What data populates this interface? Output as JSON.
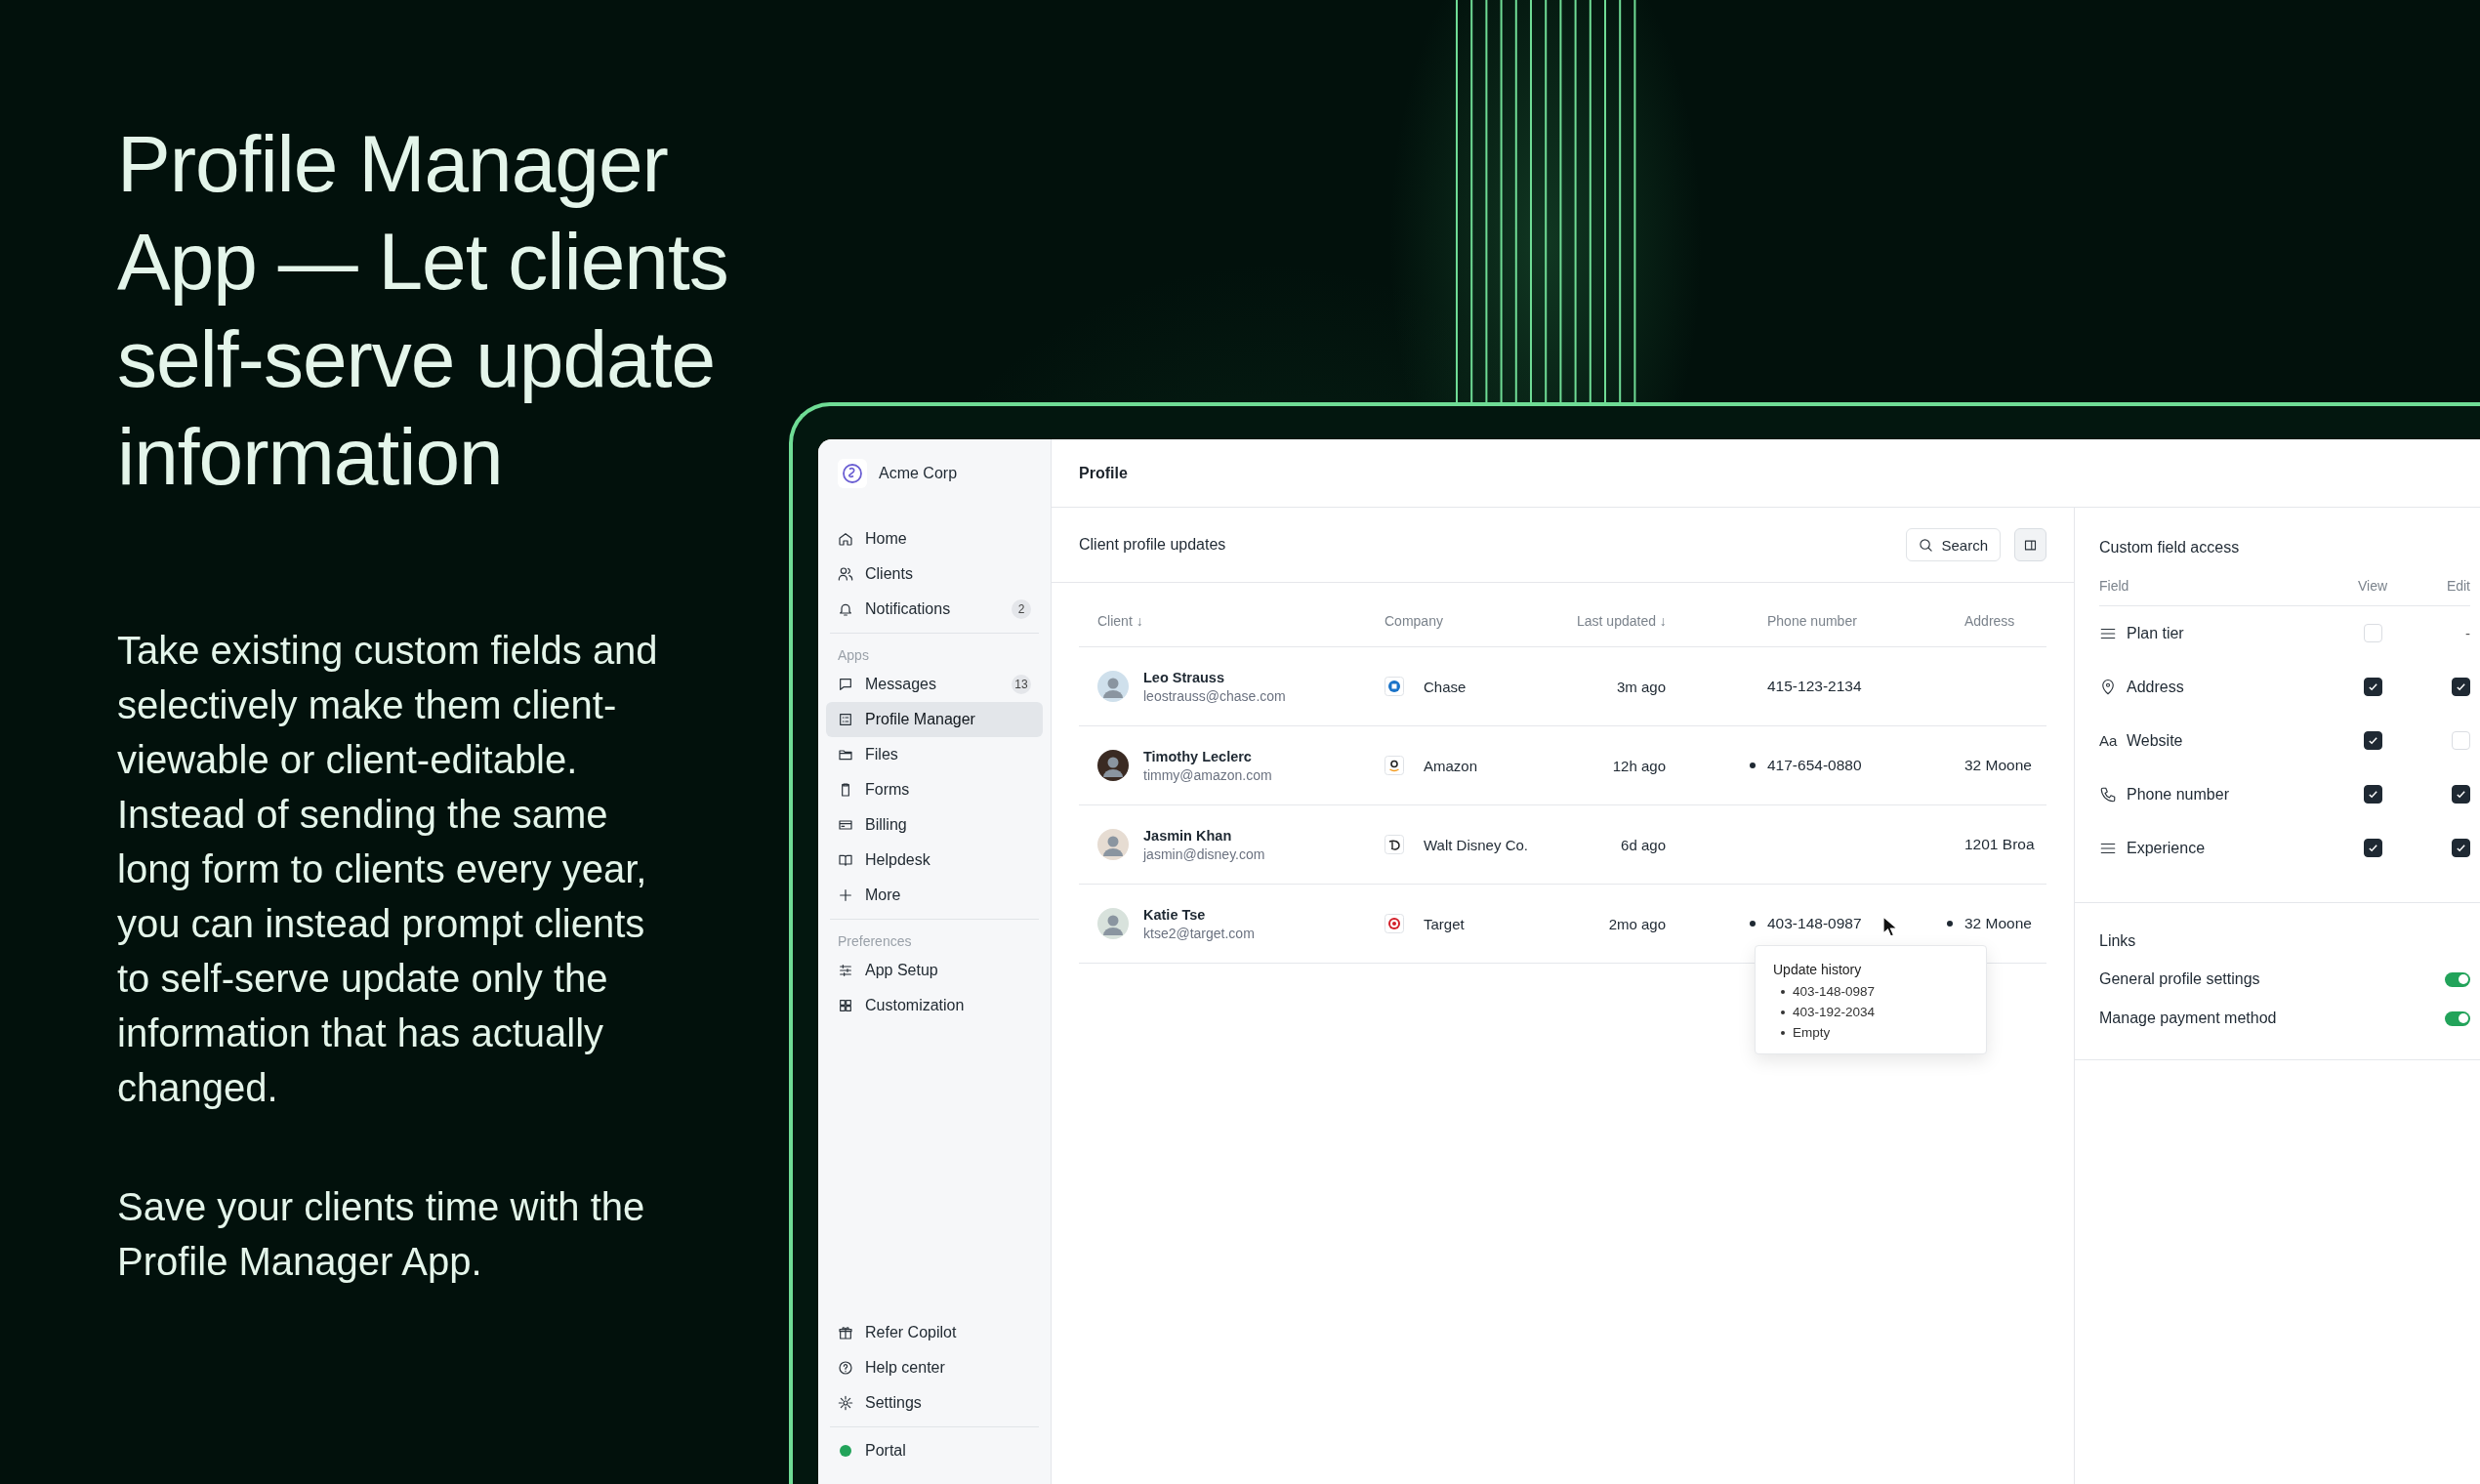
{
  "hero": {
    "title": "Profile Manager App — Let clients self-serve update information",
    "paragraphs": [
      "Take existing custom fields and selectively make them client-viewable or client-editable. Instead of sending the same long form to clients every year, you can instead prompt clients to self-serve update only the information that has actually changed.",
      "Save your clients time with the Profile Manager App."
    ]
  },
  "app": {
    "brand": "Acme Corp",
    "nav": [
      {
        "items": [
          {
            "label": "Home",
            "selected": false
          },
          {
            "label": "Clients",
            "selected": false
          },
          {
            "label": "Notifications",
            "badge": "2",
            "selected": false
          }
        ]
      },
      {
        "title": "Apps",
        "items": [
          {
            "label": "Messages",
            "badge": "13",
            "selected": false
          },
          {
            "label": "Profile Manager",
            "selected": true
          },
          {
            "label": "Files",
            "selected": false
          },
          {
            "label": "Forms",
            "selected": false
          },
          {
            "label": "Billing",
            "selected": false
          },
          {
            "label": "Helpdesk",
            "selected": false
          },
          {
            "label": "More",
            "selected": false
          }
        ]
      },
      {
        "title": "Preferences",
        "items": [
          {
            "label": "App Setup",
            "selected": false
          },
          {
            "label": "Customization",
            "selected": false
          }
        ]
      }
    ],
    "footer_nav": [
      {
        "label": "Refer Copilot",
        "selected": false
      },
      {
        "label": "Help center",
        "selected": false
      },
      {
        "label": "Settings",
        "selected": false
      }
    ],
    "portal": {
      "label": "Portal"
    },
    "page_title": "Profile",
    "section_title": "Client profile updates",
    "search_label": "Search",
    "columns": [
      "Client ↓",
      "Company",
      "Last updated ↓",
      "Phone number",
      "Address"
    ],
    "rows": [
      {
        "name": "Leo Strauss",
        "email": "leostrauss@chase.com",
        "company": "Chase",
        "updated": "3m ago",
        "phone": {
          "text": "415-123-2134",
          "changed": false
        }
      },
      {
        "name": "Timothy Leclerc",
        "email": "timmy@amazon.com",
        "company": "Amazon",
        "updated": "12h ago",
        "phone": {
          "text": "417-654-0880",
          "changed": true
        },
        "address": {
          "text": "32 Moone",
          "changed": false
        }
      },
      {
        "name": "Jasmin Khan",
        "email": "jasmin@disney.com",
        "company": "Walt Disney Co.",
        "updated": "6d ago",
        "address": {
          "text": "1201 Broa",
          "changed": false
        }
      },
      {
        "name": "Katie Tse",
        "email": "ktse2@target.com",
        "company": "Target",
        "updated": "2mo ago",
        "phone": {
          "text": "403-148-0987",
          "changed": true
        },
        "address": {
          "text": "32 Moone",
          "changed": true
        }
      }
    ],
    "tooltip": {
      "title": "Update history",
      "items": [
        "403-148-0987",
        "403-192-2034",
        "Empty"
      ]
    },
    "panel": {
      "title": "Custom field access",
      "columns": [
        "Field",
        "View",
        "Edit"
      ],
      "fields": [
        {
          "label": "Plan tier",
          "view": false,
          "edit_text": "-"
        },
        {
          "label": "Address",
          "view": true,
          "edit": true
        },
        {
          "label": "Website",
          "glyph": "Aa",
          "view": true,
          "edit": false
        },
        {
          "label": "Phone number",
          "view": true,
          "edit": true
        },
        {
          "label": "Experience",
          "view": true,
          "edit": true
        }
      ],
      "links_title": "Links",
      "links": [
        {
          "label": "General profile settings",
          "on": true
        },
        {
          "label": "Manage payment method",
          "on": true
        }
      ]
    }
  }
}
